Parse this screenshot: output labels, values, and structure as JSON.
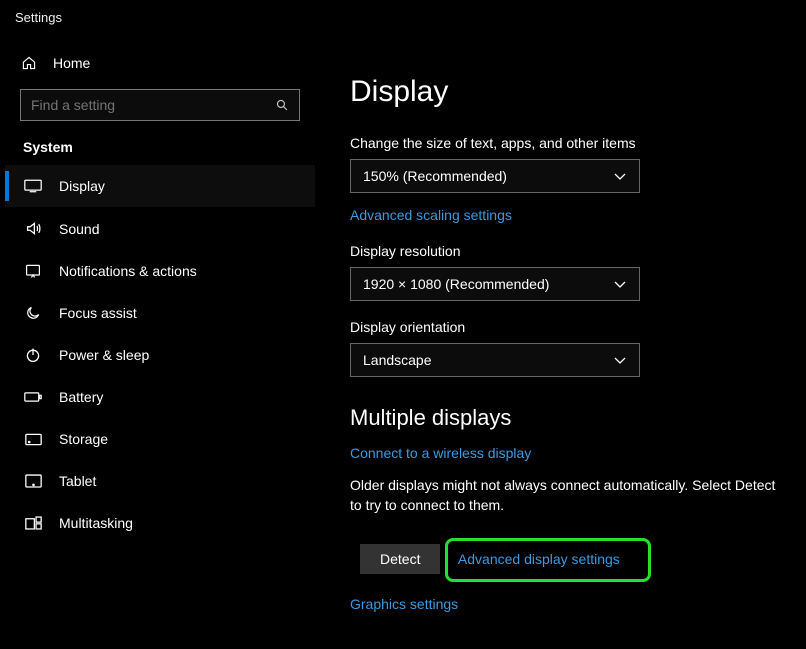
{
  "header": {
    "window_title": "Settings"
  },
  "sidebar": {
    "home_label": "Home",
    "search_placeholder": "Find a setting",
    "category_label": "System",
    "items": [
      {
        "label": "Display"
      },
      {
        "label": "Sound"
      },
      {
        "label": "Notifications & actions"
      },
      {
        "label": "Focus assist"
      },
      {
        "label": "Power & sleep"
      },
      {
        "label": "Battery"
      },
      {
        "label": "Storage"
      },
      {
        "label": "Tablet"
      },
      {
        "label": "Multitasking"
      }
    ]
  },
  "main": {
    "page_title": "Display",
    "scale": {
      "label": "Change the size of text, apps, and other items",
      "value": "150% (Recommended)",
      "link": "Advanced scaling settings"
    },
    "resolution": {
      "label": "Display resolution",
      "value": "1920 × 1080 (Recommended)"
    },
    "orientation": {
      "label": "Display orientation",
      "value": "Landscape"
    },
    "multiple_displays": {
      "title": "Multiple displays",
      "wireless_link": "Connect to a wireless display",
      "info_text": "Older displays might not always connect automatically. Select Detect to try to connect to them.",
      "detect_button": "Detect",
      "advanced_link": "Advanced display settings",
      "graphics_link": "Graphics settings"
    }
  }
}
